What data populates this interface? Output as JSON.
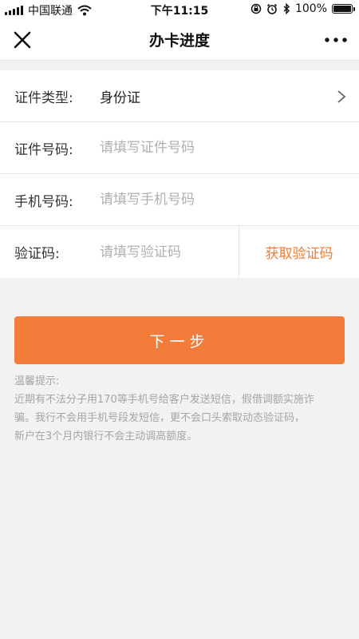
{
  "status_bar": {
    "carrier": "中国联通",
    "time": "下午11:15",
    "battery": "100%",
    "icons": [
      "signal-icon",
      "wifi-icon",
      "rotation-lock-icon",
      "alarm-icon",
      "bluetooth-icon",
      "battery-icon"
    ]
  },
  "nav": {
    "title": "办卡进度",
    "icons": [
      "close-icon",
      "more-icon"
    ]
  },
  "form": {
    "id_type": {
      "label": "证件类型:",
      "value": "身份证",
      "icon": "chevron-right-icon"
    },
    "id_number": {
      "label": "证件号码:",
      "placeholder": "请填写证件号码",
      "value": ""
    },
    "phone": {
      "label": "手机号码:",
      "placeholder": "请填写手机号码",
      "value": ""
    },
    "code": {
      "label": "验证码:",
      "placeholder": "请填写验证码",
      "value": "",
      "button": "获取验证码"
    }
  },
  "next_button": "下一步",
  "tips": {
    "title": "温馨提示:",
    "lines": [
      "近期有不法分子用170等手机号给客户发送短信，假借调额实施诈",
      "骗。我行不会用手机号段发短信，更不会口头索取动态验证码，",
      "新户在3个月内银行不会主动调高额度。"
    ]
  },
  "colors": {
    "accent": "#f47c3a",
    "link": "#f07c33",
    "background": "#f2f2f2",
    "placeholder": "#b0b0b0"
  }
}
